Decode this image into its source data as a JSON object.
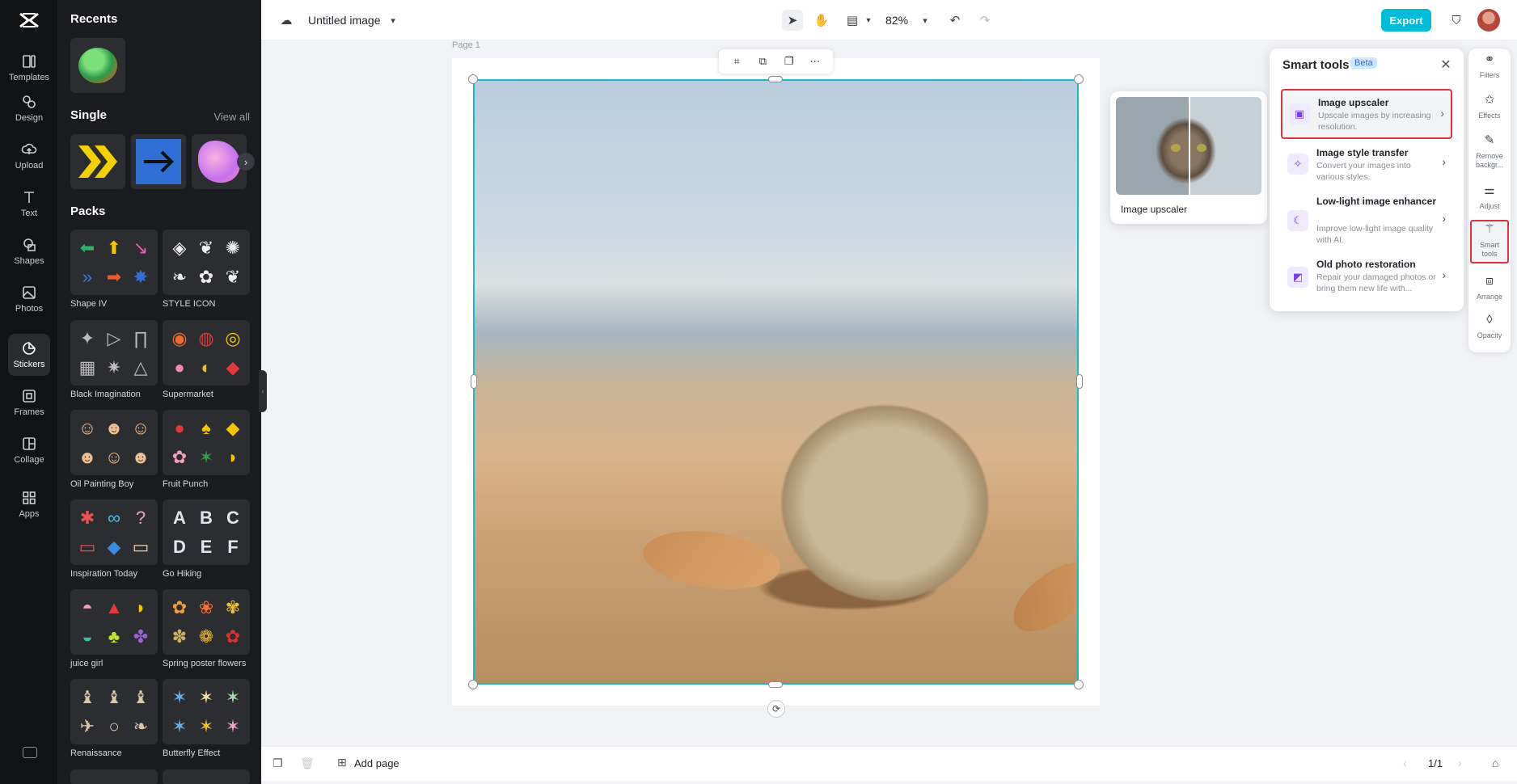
{
  "header": {
    "title": "Untitled image",
    "zoom": "82%",
    "export_label": "Export"
  },
  "rail": {
    "items": [
      {
        "label": "Templates",
        "icon": "templates-icon"
      },
      {
        "label": "Design",
        "icon": "design-icon"
      },
      {
        "label": "Upload",
        "icon": "upload-icon"
      },
      {
        "label": "Text",
        "icon": "text-icon"
      },
      {
        "label": "Shapes",
        "icon": "shapes-icon"
      },
      {
        "label": "Photos",
        "icon": "photos-icon"
      },
      {
        "label": "Stickers",
        "icon": "stickers-icon"
      },
      {
        "label": "Frames",
        "icon": "frames-icon"
      },
      {
        "label": "Collage",
        "icon": "collage-icon"
      },
      {
        "label": "Apps",
        "icon": "apps-icon"
      }
    ],
    "active": "Stickers"
  },
  "panel": {
    "recents_title": "Recents",
    "single_title": "Single",
    "view_all": "View all",
    "packs_title": "Packs",
    "packs": [
      {
        "name": "Shape IV",
        "glyphs": [
          "⬅",
          "⬆",
          "↘",
          "»",
          "➡",
          "✸"
        ]
      },
      {
        "name": "STYLE ICON",
        "glyphs": [
          "◈",
          "❦",
          "✺",
          "❧",
          "✿",
          "❦"
        ]
      },
      {
        "name": "Black Imagination",
        "glyphs": [
          "✦",
          "▷",
          "∏",
          "▦",
          "✷",
          "△"
        ]
      },
      {
        "name": "Supermarket",
        "glyphs": [
          "◉",
          "◍",
          "◎",
          "●",
          "◐",
          "◆"
        ]
      },
      {
        "name": "Oil Painting Boy",
        "glyphs": [
          "☺",
          "☻",
          "☺",
          "☻",
          "☺",
          "☻"
        ]
      },
      {
        "name": "Fruit Punch",
        "glyphs": [
          "●",
          "♠",
          "◆",
          "✿",
          "✶",
          "◗"
        ]
      },
      {
        "name": "Inspiration Today",
        "glyphs": [
          "✱",
          "∞",
          "?",
          "▭",
          "◆",
          "▭"
        ]
      },
      {
        "name": "Go Hiking",
        "glyphs": [
          "A",
          "B",
          "C",
          "D",
          "E",
          "F"
        ]
      },
      {
        "name": "juice girl",
        "glyphs": [
          "◓",
          "▲",
          "◗",
          "◒",
          "♣",
          "✤"
        ]
      },
      {
        "name": "Spring poster flowers",
        "glyphs": [
          "✿",
          "❀",
          "✾",
          "✽",
          "❁",
          "✿"
        ]
      },
      {
        "name": "Renaissance",
        "glyphs": [
          "♝",
          "♝",
          "♝",
          "✈",
          "○",
          "❧"
        ]
      },
      {
        "name": "Butterfly Effect",
        "glyphs": [
          "✶",
          "✶",
          "✶",
          "✶",
          "✶",
          "✶"
        ]
      }
    ]
  },
  "canvas": {
    "page_label": "Page 1"
  },
  "preview": {
    "title": "Image upscaler"
  },
  "smart_tools": {
    "title": "Smart tools",
    "badge": "Beta",
    "items": [
      {
        "name": "Image upscaler",
        "desc": "Upscale images by increasing resolution.",
        "highlighted": true
      },
      {
        "name": "Image style transfer",
        "desc": "Convert your images into various styles.",
        "highlighted": false
      },
      {
        "name": "Low-light image enhancer",
        "desc": "Improve low-light image quality with AI.",
        "highlighted": false
      },
      {
        "name": "Old photo restoration",
        "desc": "Repair your damaged photos or bring them new life with...",
        "highlighted": false
      }
    ]
  },
  "right_rail": {
    "items": [
      {
        "label": "Filters"
      },
      {
        "label": "Effects"
      },
      {
        "label": "Remove backgr..."
      },
      {
        "label": "Adjust"
      },
      {
        "label": "Smart tools"
      },
      {
        "label": "Arrange"
      },
      {
        "label": "Opacity"
      }
    ]
  },
  "bottom": {
    "add_page": "Add page",
    "pager": "1/1"
  },
  "colors": {
    "accent": "#00bcd8",
    "selection": "#1fb6c9",
    "highlight": "#e0313f"
  }
}
